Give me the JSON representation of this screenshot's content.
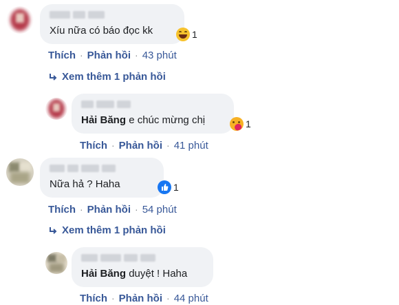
{
  "actions": {
    "like": "Thích",
    "reply": "Phản hồi",
    "dot": "·"
  },
  "comments": [
    {
      "text": "Xíu nữa có báo đọc kk",
      "reaction_icon": "haha-emoji-icon",
      "reaction_count": "1",
      "time": "43 phút"
    },
    {
      "tag": "Hải Băng",
      "text": "e chúc mừng chị",
      "reaction_icon": "care-emoji-icon",
      "reaction_count": "1",
      "time": "41 phút"
    },
    {
      "text": "Nữa hả ? Haha",
      "reaction_icon": "like-icon",
      "reaction_count": "1",
      "time": "54 phút"
    },
    {
      "tag": "Hải Băng",
      "text": "duyệt ! Haha",
      "time": "44 phút"
    }
  ],
  "view_more": [
    {
      "label": "Xem thêm 1 phản hồi"
    },
    {
      "label": "Xem thêm 1 phản hồi"
    }
  ],
  "colors": {
    "link": "#385898",
    "bubble": "#f0f2f5",
    "like_blue": "#1877f2",
    "haha_yellow": "#f7c22d"
  }
}
